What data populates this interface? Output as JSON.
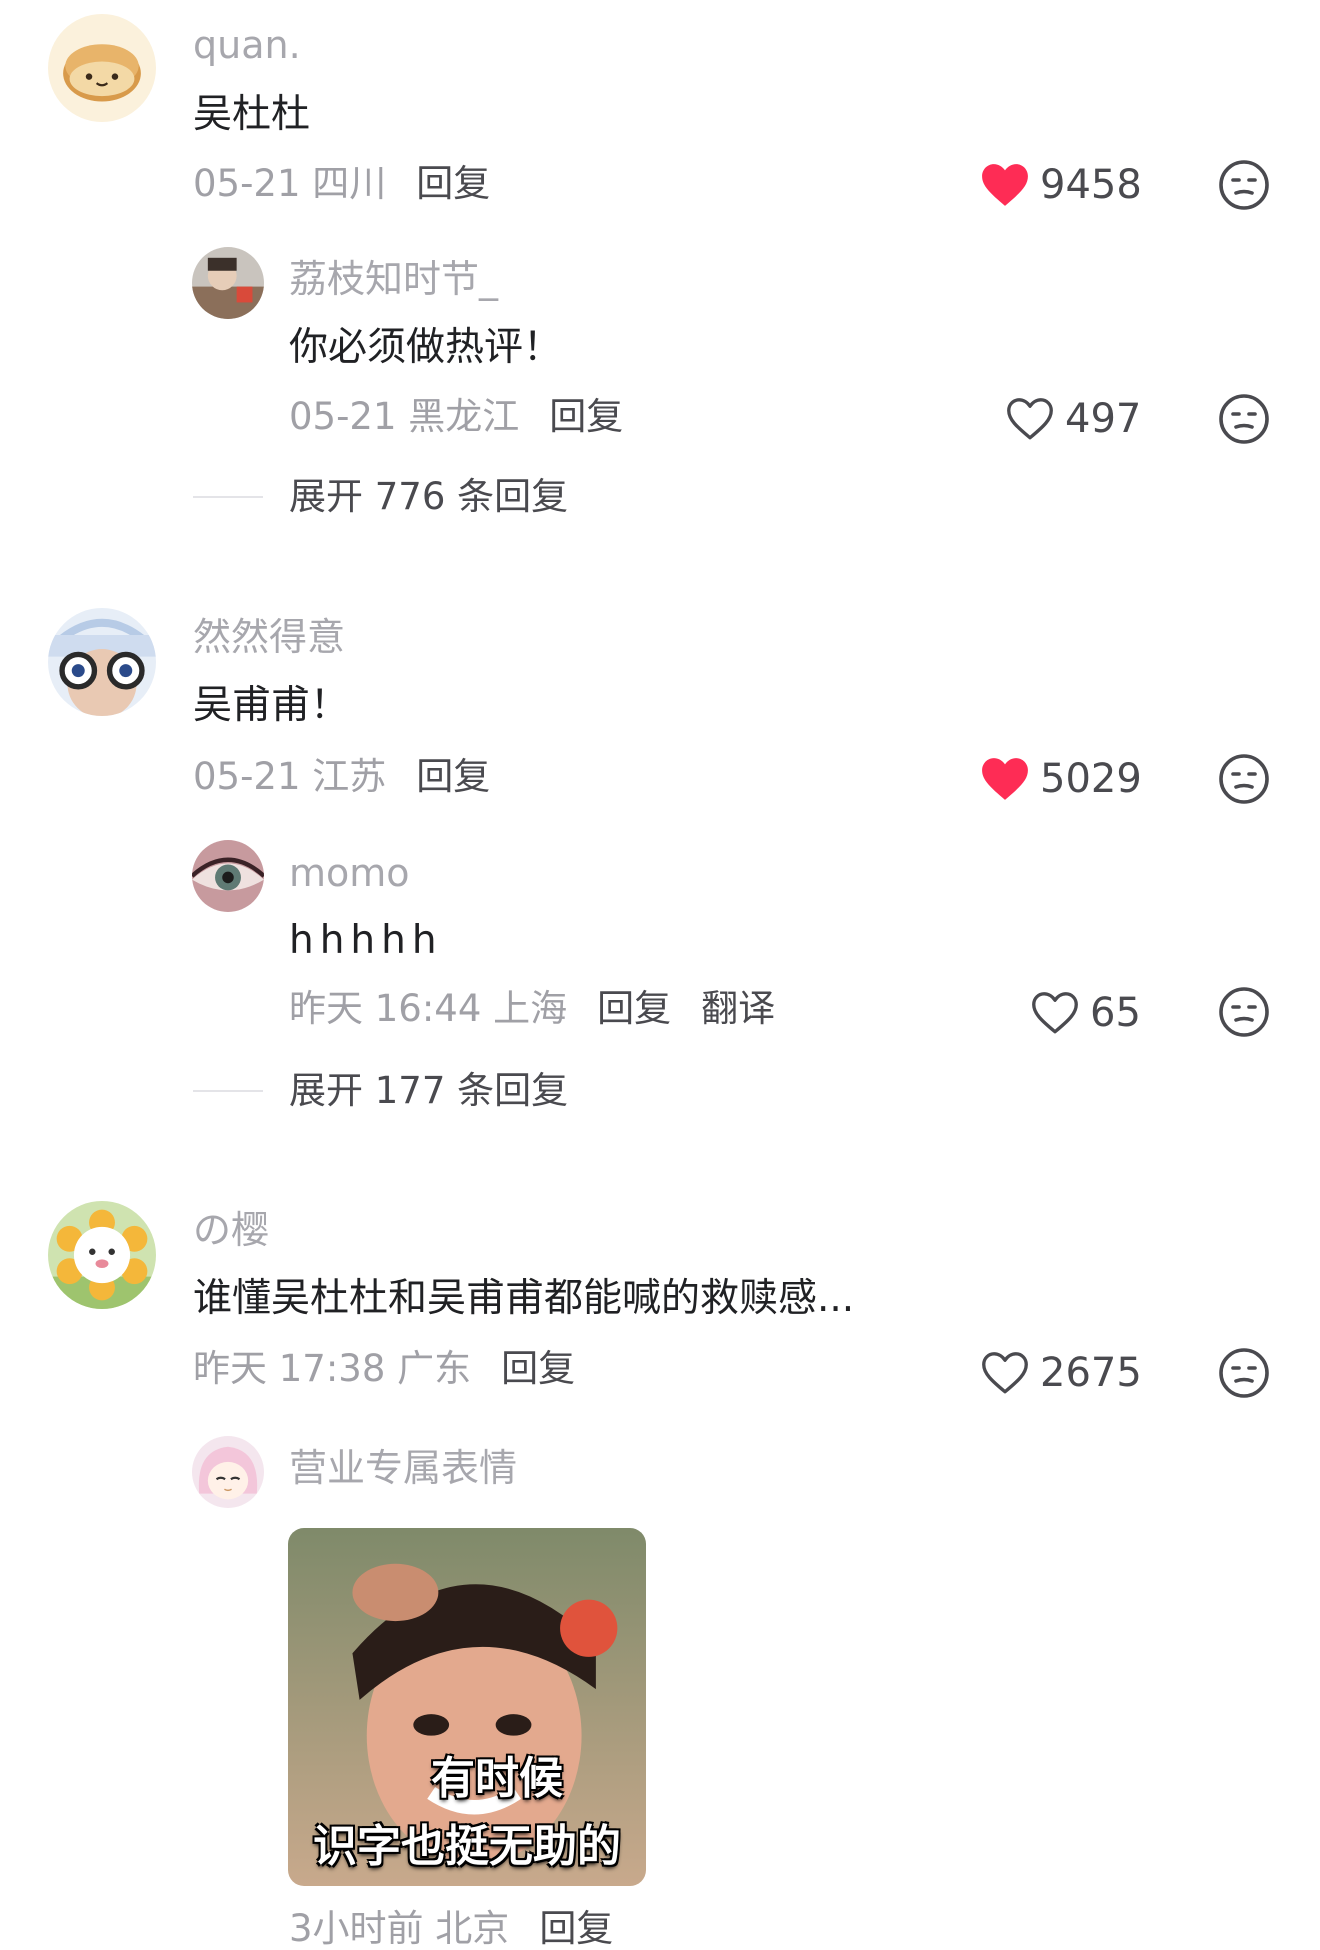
{
  "comments": [
    {
      "user": "quan.",
      "text": "吴杜杜",
      "date_loc": "05-21 四川",
      "reply_label": "回复",
      "likes": "9458",
      "liked": true,
      "reply": {
        "user": "荔枝知时节_",
        "text": "你必须做热评！",
        "date_loc": "05-21 黑龙江",
        "reply_label": "回复",
        "likes": "497",
        "liked": false
      },
      "expand_label": "展开 776 条回复"
    },
    {
      "user": "然然得意",
      "text": "吴甫甫！",
      "date_loc": "05-21 江苏",
      "reply_label": "回复",
      "likes": "5029",
      "liked": true,
      "reply": {
        "user": "momo",
        "text": "hhhhh",
        "date_loc": "昨天 16:44 上海",
        "reply_label": "回复",
        "translate_label": "翻译",
        "likes": "65",
        "liked": false
      },
      "expand_label": "展开 177 条回复"
    },
    {
      "user": "の樱",
      "text": "谁懂吴杜杜和吴甫甫都能喊的救赎感...",
      "date_loc": "昨天 17:38 广东",
      "reply_label": "回复",
      "likes": "2675",
      "liked": false,
      "reply": {
        "user": "营业专属表情",
        "sticker_caption_1": "有时候",
        "sticker_caption_2": "识字也挺无助的",
        "date_loc": "3小时前 北京",
        "reply_label": "回复"
      }
    }
  ],
  "colors": {
    "liked_heart": "#fe2c55",
    "meta_gray": "#a0a0a6",
    "username_gray": "#a7a7ad",
    "text_dark": "#202124"
  },
  "icons": {
    "like": "heart-icon",
    "dislike": "unamused-face-icon"
  }
}
